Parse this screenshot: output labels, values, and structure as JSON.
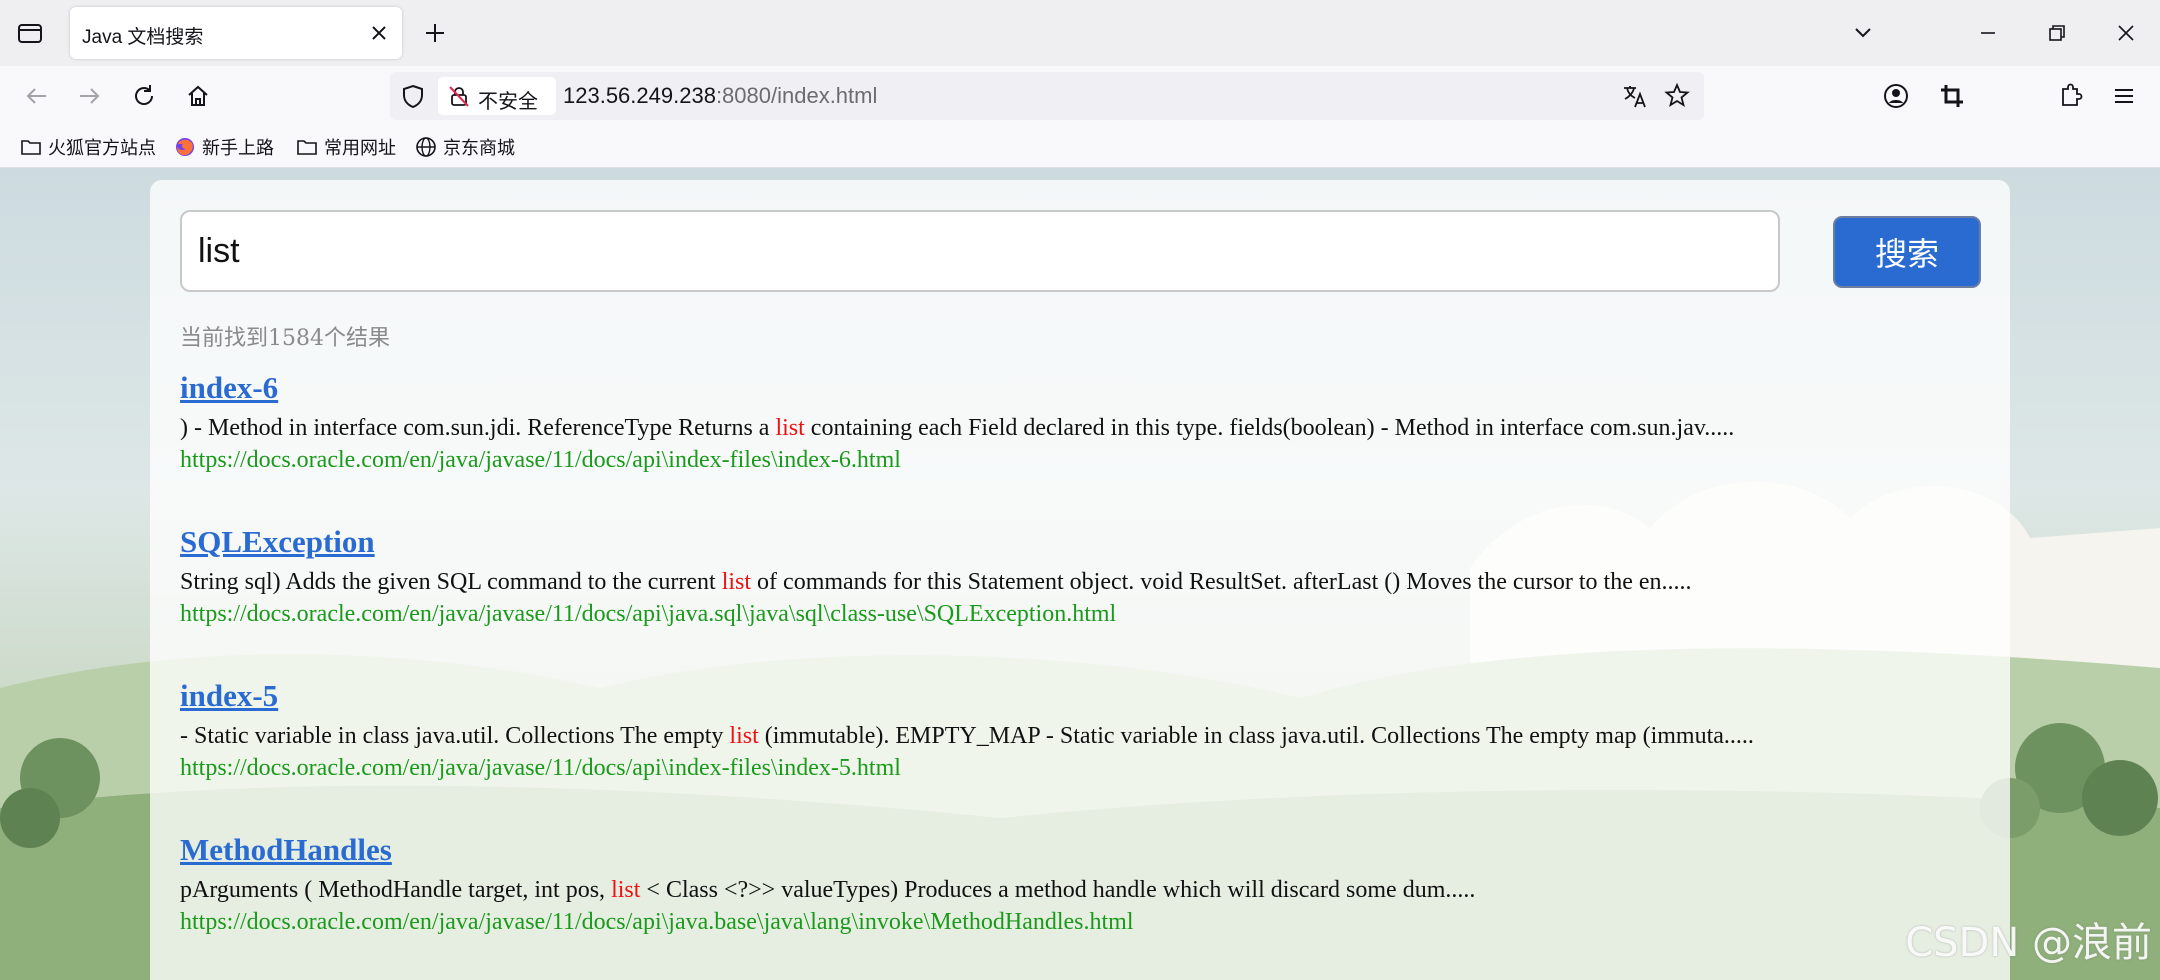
{
  "browser": {
    "tab": {
      "title": "Java 文档搜索"
    },
    "security_label": "不安全",
    "url": {
      "host": "123.56.249.238",
      "rest": ":8080/index.html"
    },
    "bookmarks": [
      "火狐官方站点",
      "新手上路",
      "常用网址",
      "京东商城"
    ]
  },
  "search": {
    "query": "list",
    "button_label": "搜索",
    "result_count_text": "当前找到1584个结果"
  },
  "results": [
    {
      "title": "index-6",
      "desc_before": ") - Method in interface com.sun.jdi. ReferenceType Returns a ",
      "highlight": "list",
      "desc_after": " containing each Field declared in this type. fields(boolean) - Method in interface com.sun.jav.....",
      "url": "https://docs.oracle.com/en/java/javase/11/docs/api\\index-files\\index-6.html"
    },
    {
      "title": "SQLException",
      "desc_before": "String  sql) Adds the given SQL command to the current ",
      "highlight": "list",
      "desc_after": " of commands for this Statement object. void ResultSet. afterLast () Moves the cursor to the en.....",
      "url": "https://docs.oracle.com/en/java/javase/11/docs/api\\java.sql\\java\\sql\\class-use\\SQLException.html"
    },
    {
      "title": "index-5",
      "desc_before": "- Static variable in class java.util. Collections The empty ",
      "highlight": "list",
      "desc_after": " (immutable). EMPTY_MAP - Static variable in class java.util. Collections The empty map (immuta.....",
      "url": "https://docs.oracle.com/en/java/javase/11/docs/api\\index-files\\index-5.html"
    },
    {
      "title": "MethodHandles",
      "desc_before": "pArguments ( MethodHandle  target, int pos, ",
      "highlight": "list",
      "desc_after": " < Class <?>> valueTypes) Produces a method handle which will discard some dum.....",
      "url": "https://docs.oracle.com/en/java/javase/11/docs/api\\java.base\\java\\lang\\invoke\\MethodHandles.html"
    }
  ],
  "watermark": "CSDN @浪前",
  "colors": {
    "accent": "#2a6bd1",
    "highlight": "#ee1111",
    "url": "#1a9a1a"
  }
}
